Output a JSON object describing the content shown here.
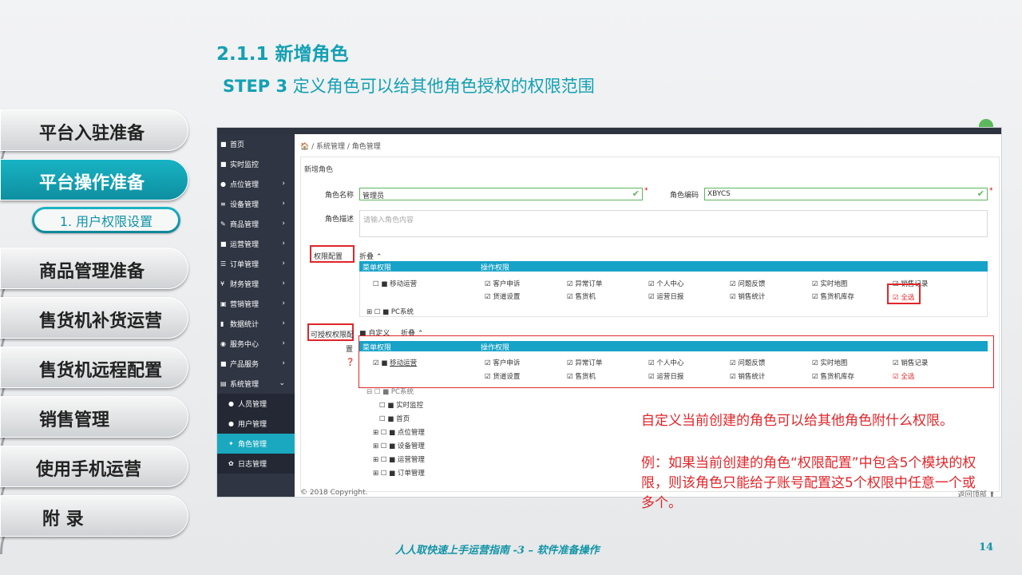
{
  "heading": "2.1.1 新增角色",
  "step": {
    "prefix": "STEP 3",
    "text": " 定义角色可以给其他角色授权的权限范围"
  },
  "nav": {
    "tabs": [
      "平台入驻准备",
      "平台操作准备",
      "商品管理准备",
      "售货机补货运营",
      "售货机远程配置",
      "销售管理",
      "使用手机运营",
      "附 录"
    ],
    "active_sub": "1. 用户权限设置"
  },
  "app": {
    "sidebar": [
      "首页",
      "实时监控",
      "点位管理",
      "设备管理",
      "商品管理",
      "运营管理",
      "订单管理",
      "财务管理",
      "营销管理",
      "数据统计",
      "服务中心",
      "产品服务",
      "系统管理"
    ],
    "sidebar_sub": [
      "人员管理",
      "用户管理",
      "角色管理",
      "日志管理"
    ],
    "breadcrumb": "🏠 / 系统管理 / 角色管理",
    "form_title": "新增角色",
    "role_name_label": "角色名称",
    "role_name_value": "管理员",
    "role_code_label": "角色编码",
    "role_code_value": "XBYCS",
    "desc_label": "角色描述",
    "desc_placeholder": "请输入角色内容",
    "perm_label": "权限配置",
    "collapse": "折叠 ⌃",
    "grant_label_1": "可授权权限配",
    "grant_label_2": "置",
    "custom": "自定义",
    "collapse2": "折叠 ⌃",
    "col_menu": "菜单权限",
    "col_op": "操作权限",
    "row1_menu": "移动运营",
    "ops_row1": [
      "客户申诉",
      "异常订单",
      "个人中心",
      "问题反馈",
      "实时地图",
      "销售记录"
    ],
    "ops_row2": [
      "货道设置",
      "售货机",
      "运营日报",
      "销售统计",
      "售货机库存"
    ],
    "select_all": "全选",
    "pc_system": "PC系统",
    "pc_children": [
      "实时监控",
      "首页",
      "点位管理",
      "设备管理",
      "运营管理",
      "订单管理"
    ],
    "copyright": "© 2018 Copyright.",
    "back_top": "返回顶部 ⬆"
  },
  "note1": "自定义当前创建的角色可以给其他角色附什么权限。",
  "note2": "例：如果当前创建的角色“权限配置”中包含5个模块的权限，则该角色只能给子账号配置这5个权限中任意一个或多个。",
  "footer_title": "人人取快速上手运营指南 -3 – 软件准备操作",
  "page_number": "14",
  "colors": {
    "accent": "#14a0b4",
    "red": "#e0262a",
    "sidebar": "#2f3542"
  }
}
